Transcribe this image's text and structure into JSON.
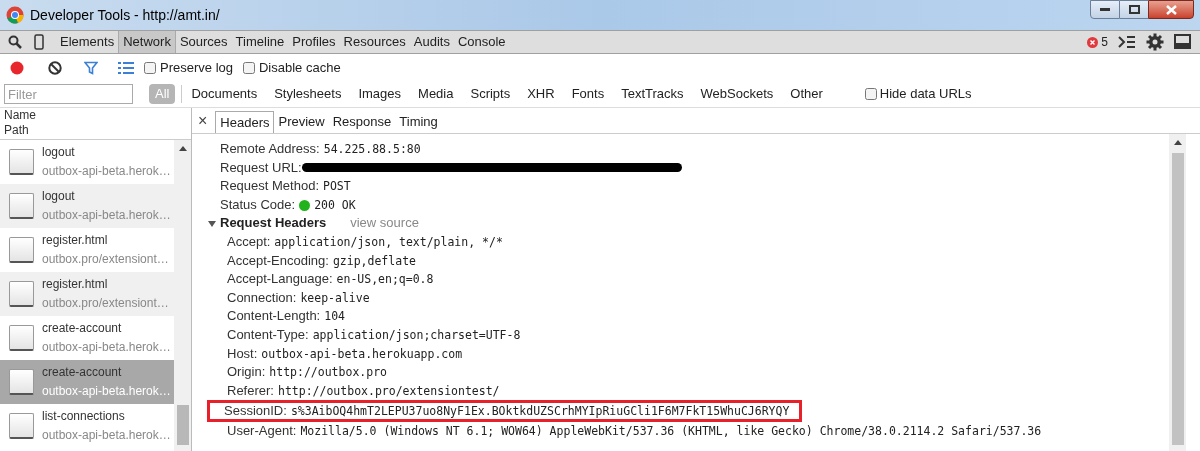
{
  "window": {
    "title": "Developer Tools - http://amt.in/"
  },
  "main_tabs": [
    {
      "label": "Elements",
      "selected": false
    },
    {
      "label": "Network",
      "selected": true
    },
    {
      "label": "Sources",
      "selected": false
    },
    {
      "label": "Timeline",
      "selected": false
    },
    {
      "label": "Profiles",
      "selected": false
    },
    {
      "label": "Resources",
      "selected": false
    },
    {
      "label": "Audits",
      "selected": false
    },
    {
      "label": "Console",
      "selected": false
    }
  ],
  "error_count": "5",
  "network_toolbar": {
    "recording": true,
    "options": [
      {
        "label": "Preserve log",
        "checked": false
      },
      {
        "label": "Disable cache",
        "checked": false
      }
    ]
  },
  "filter": {
    "placeholder": "Filter",
    "types": [
      {
        "label": "All",
        "selected": true
      },
      {
        "label": "Documents",
        "selected": false
      },
      {
        "label": "Stylesheets",
        "selected": false
      },
      {
        "label": "Images",
        "selected": false
      },
      {
        "label": "Media",
        "selected": false
      },
      {
        "label": "Scripts",
        "selected": false
      },
      {
        "label": "XHR",
        "selected": false
      },
      {
        "label": "Fonts",
        "selected": false
      },
      {
        "label": "TextTracks",
        "selected": false
      },
      {
        "label": "WebSockets",
        "selected": false
      },
      {
        "label": "Other",
        "selected": false
      }
    ],
    "hide_data_urls": {
      "label": "Hide data URLs",
      "checked": false
    }
  },
  "requests": {
    "columns": [
      "Name",
      "Path"
    ],
    "items": [
      {
        "name": "logout",
        "path": "outbox-api-beta.herok…",
        "selected": false
      },
      {
        "name": "logout",
        "path": "outbox-api-beta.herok…",
        "selected": false
      },
      {
        "name": "register.html",
        "path": "outbox.pro/extensiont…",
        "selected": false
      },
      {
        "name": "register.html",
        "path": "outbox.pro/extensiont…",
        "selected": false
      },
      {
        "name": "create-account",
        "path": "outbox-api-beta.herok…",
        "selected": false
      },
      {
        "name": "create-account",
        "path": "outbox-api-beta.herok…",
        "selected": true
      },
      {
        "name": "list-connections",
        "path": "outbox-api-beta.herok…",
        "selected": false
      }
    ]
  },
  "detail": {
    "close": "×",
    "tabs": [
      {
        "label": "Headers",
        "selected": true
      },
      {
        "label": "Preview",
        "selected": false
      },
      {
        "label": "Response",
        "selected": false
      },
      {
        "label": "Timing",
        "selected": false
      }
    ],
    "general": [
      {
        "kind": "text",
        "key": "Remote Address:",
        "value": "54.225.88.5:80"
      },
      {
        "kind": "redacted",
        "key": "Request URL:"
      },
      {
        "kind": "text",
        "key": "Request Method:",
        "value": "POST"
      },
      {
        "kind": "status",
        "key": "Status Code:",
        "value": "200 OK",
        "color": "#22b21e"
      }
    ],
    "request_headers": {
      "title": "Request Headers",
      "link": "view source",
      "expanded": true,
      "headers": [
        {
          "key": "Accept:",
          "value": "application/json, text/plain, */*",
          "highlighted": false
        },
        {
          "key": "Accept-Encoding:",
          "value": "gzip,deflate",
          "highlighted": false
        },
        {
          "key": "Accept-Language:",
          "value": "en-US,en;q=0.8",
          "highlighted": false
        },
        {
          "key": "Connection:",
          "value": "keep-alive",
          "highlighted": false
        },
        {
          "key": "Content-Length:",
          "value": "104",
          "highlighted": false
        },
        {
          "key": "Content-Type:",
          "value": "application/json;charset=UTF-8",
          "highlighted": false
        },
        {
          "key": "Host:",
          "value": "outbox-api-beta.herokuapp.com",
          "highlighted": false
        },
        {
          "key": "Origin:",
          "value": "http://outbox.pro",
          "highlighted": false
        },
        {
          "key": "Referer:",
          "value": "http://outbox.pro/extensiontest/",
          "highlighted": false
        },
        {
          "key": "SessionID:",
          "value": "s%3AibOQ4hmT2LEPU37uo8NyF1Ex.BOktkdUZSCrhMYIpRiuGCli1F6M7FkT15WhuCJ6RYQY",
          "highlighted": true
        },
        {
          "key": "User-Agent:",
          "value": "Mozilla/5.0 (Windows NT 6.1; WOW64) AppleWebKit/537.36 (KHTML, like Gecko) Chrome/38.0.2114.2 Safari/537.36",
          "highlighted": false
        }
      ]
    }
  }
}
